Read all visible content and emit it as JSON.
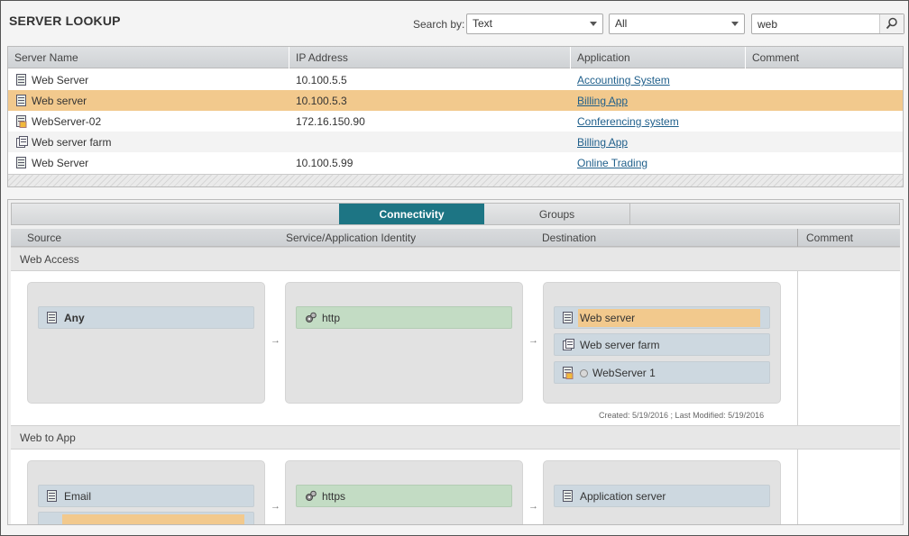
{
  "page_title": "SERVER LOOKUP",
  "search": {
    "by_label": "Search by:",
    "type_value": "Text",
    "scope_value": "All",
    "query": "web"
  },
  "table": {
    "headers": [
      "Server Name",
      "IP Address",
      "Application",
      "Comment"
    ],
    "rows": [
      {
        "name": "Web Server",
        "ip": "10.100.5.5",
        "app": "Accounting System",
        "comment": "",
        "icon": "server-icon"
      },
      {
        "name": "Web server",
        "ip": "10.100.5.3",
        "app": "Billing App",
        "comment": "",
        "icon": "server-icon"
      },
      {
        "name": "WebServer-02",
        "ip": "172.16.150.90",
        "app": "Conferencing system",
        "comment": "",
        "icon": "server-warning-icon"
      },
      {
        "name": "Web server farm",
        "ip": "",
        "app": "Billing App",
        "comment": "",
        "icon": "server-farm-icon"
      },
      {
        "name": "Web Server",
        "ip": "10.100.5.99",
        "app": "Online Trading",
        "comment": "",
        "icon": "server-icon"
      }
    ]
  },
  "tabs": {
    "connectivity": "Connectivity",
    "groups": "Groups"
  },
  "columns": {
    "source": "Source",
    "service": "Service/Application Identity",
    "destination": "Destination",
    "comment": "Comment"
  },
  "sections": [
    {
      "title": "Web Access",
      "source": [
        "Any"
      ],
      "service": [
        "http"
      ],
      "destination": [
        "Web server",
        "Web server farm",
        "WebServer 1"
      ],
      "meta": "Created: 5/19/2016 ; Last Modified: 5/19/2016"
    },
    {
      "title": "Web to App",
      "source": [
        "Email"
      ],
      "service": [
        "https"
      ],
      "destination": [
        "Application server"
      ]
    }
  ],
  "arrow_glyph": "→",
  "colors": {
    "accent": "#1d7584",
    "selection": "#f2c98d",
    "link": "#1f5f8b"
  }
}
